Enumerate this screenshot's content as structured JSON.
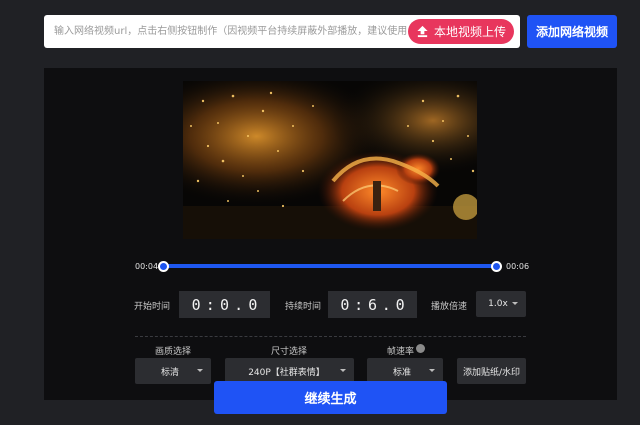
{
  "top_bar": {
    "url_placeholder": "输入网络视频url，点击右侧按钮制作（因视频平台持续屏蔽外部播放，建议使用",
    "upload_label": "本地视频上传",
    "add_network_label": "添加网络视频"
  },
  "timeline": {
    "start_time": "00:04",
    "end_time": "00:06"
  },
  "controls": {
    "start_label": "开始时间",
    "start_digits": [
      "0",
      ":",
      "0",
      ".",
      "0"
    ],
    "duration_label": "持续时间",
    "duration_digits": [
      "0",
      ":",
      "6",
      ".",
      "0"
    ],
    "speed_label": "播放倍速",
    "speed_value": "1.0x",
    "quality_label": "画质选择",
    "quality_value": "标清",
    "size_label": "尺寸选择",
    "size_value": "240P【社群表情】",
    "framerate_label": "帧速率",
    "framerate_value": "标准",
    "sticker_label": "添加贴纸/水印"
  },
  "generate_label": "继续生成",
  "colors": {
    "accent_blue": "#1f53f5",
    "upload_pink": "#e8365d",
    "panel_bg": "#0e0e10",
    "page_bg": "#202125"
  }
}
